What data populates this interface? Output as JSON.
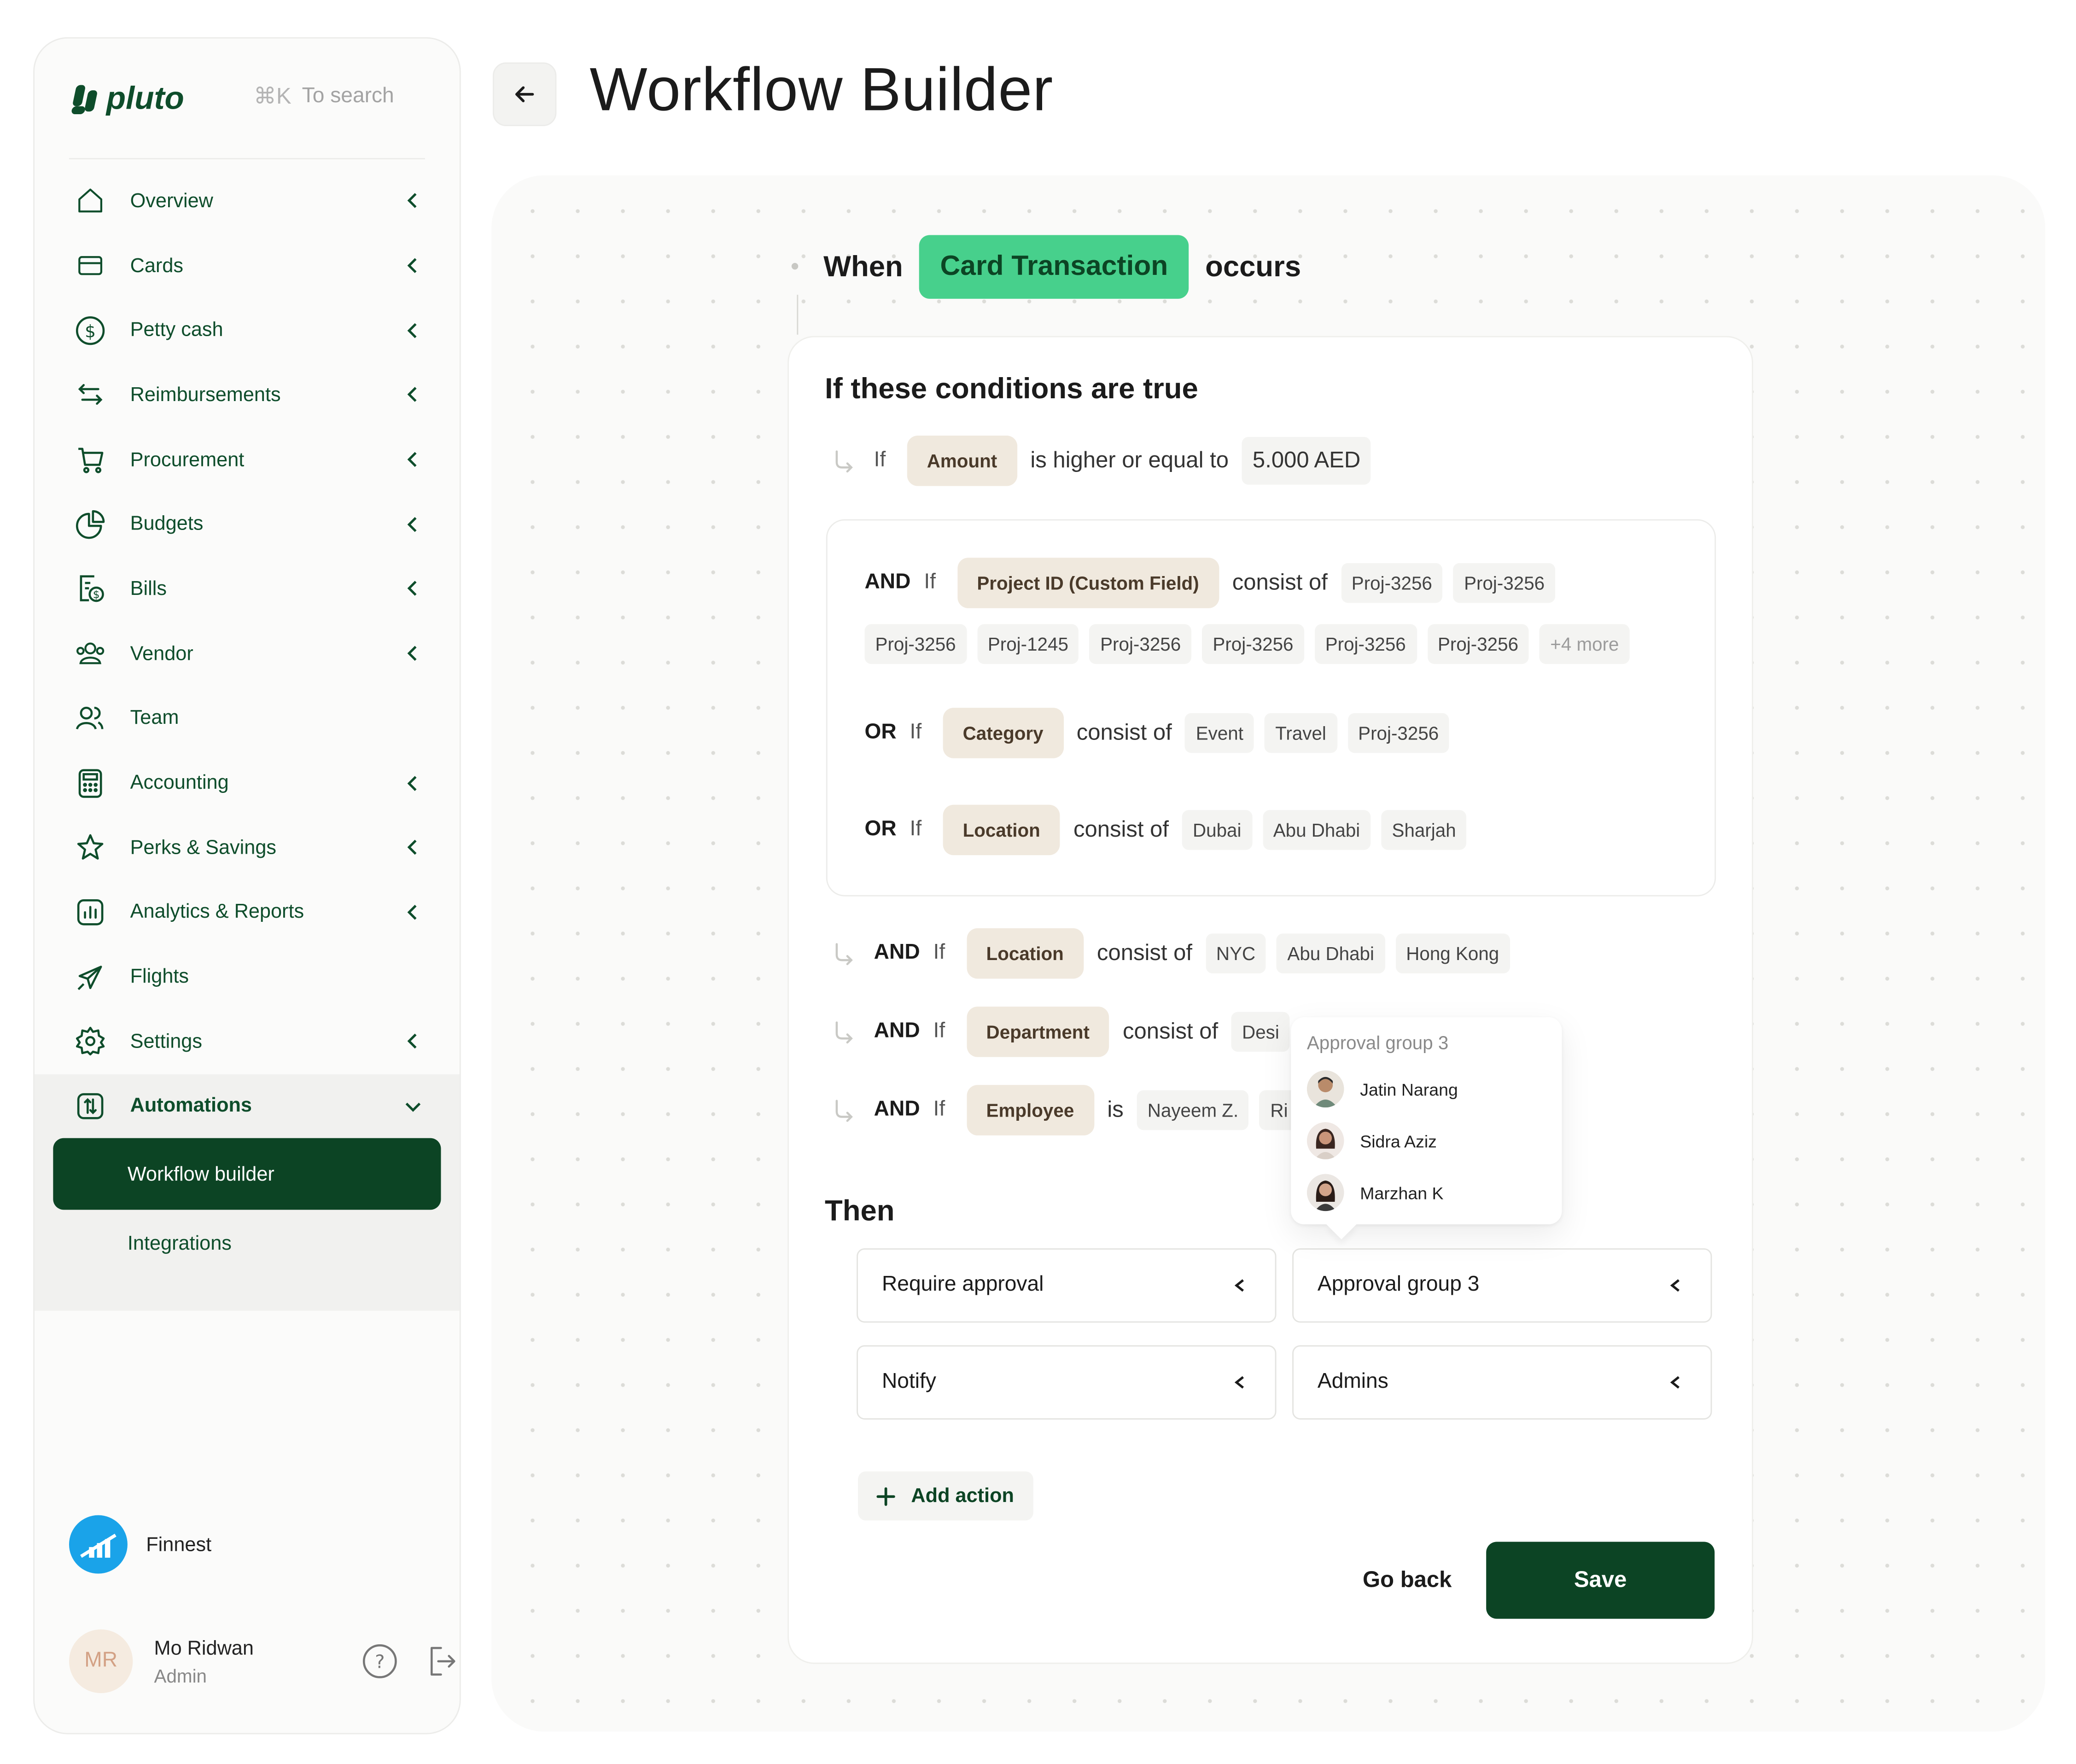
{
  "brand": {
    "name": "pluto"
  },
  "search": {
    "shortcut": "⌘K",
    "hint": "To search"
  },
  "sidebar": {
    "items": [
      {
        "label": "Overview",
        "icon": "home-icon",
        "chevron": true
      },
      {
        "label": "Cards",
        "icon": "card-icon",
        "chevron": true
      },
      {
        "label": "Petty cash",
        "icon": "dollar-icon",
        "chevron": true
      },
      {
        "label": "Reimbursements",
        "icon": "transfer-icon",
        "chevron": true
      },
      {
        "label": "Procurement",
        "icon": "cart-icon",
        "chevron": true
      },
      {
        "label": "Budgets",
        "icon": "pie-icon",
        "chevron": true
      },
      {
        "label": "Bills",
        "icon": "bill-icon",
        "chevron": true
      },
      {
        "label": "Vendor",
        "icon": "vendor-icon",
        "chevron": true
      },
      {
        "label": "Team",
        "icon": "team-icon",
        "chevron": false
      },
      {
        "label": "Accounting",
        "icon": "calculator-icon",
        "chevron": true
      },
      {
        "label": "Perks & Savings",
        "icon": "star-icon",
        "chevron": true
      },
      {
        "label": "Analytics & Reports",
        "icon": "analytics-icon",
        "chevron": true
      },
      {
        "label": "Flights",
        "icon": "plane-icon",
        "chevron": false
      },
      {
        "label": "Settings",
        "icon": "gear-icon",
        "chevron": true
      },
      {
        "label": "Automations",
        "icon": "automation-icon",
        "chevron": true,
        "expanded": true
      }
    ],
    "subitems": [
      {
        "label": "Workflow builder",
        "selected": true
      },
      {
        "label": "Integrations",
        "selected": false
      }
    ],
    "company": "Finnest",
    "user": {
      "initials": "MR",
      "name": "Mo Ridwan",
      "role": "Admin"
    }
  },
  "header": {
    "title": "Workflow Builder"
  },
  "trigger": {
    "when": "When",
    "event": "Card Transaction",
    "occurs": "occurs"
  },
  "conditions": {
    "title": "If these conditions are true",
    "first": {
      "if": "If",
      "field": "Amount",
      "op": "is higher or equal to",
      "value": "5.000 AED"
    },
    "group": {
      "row1": {
        "kw": "AND",
        "if": "If",
        "field": "Project ID (Custom Field)",
        "op": "consist of",
        "chips_a": [
          "Proj-3256",
          "Proj-3256"
        ],
        "chips_b": [
          "Proj-3256",
          "Proj-1245",
          "Proj-3256",
          "Proj-3256",
          "Proj-3256",
          "Proj-3256"
        ],
        "more": "+4 more"
      },
      "row2": {
        "kw": "OR",
        "if": "If",
        "field": "Category",
        "op": "consist of",
        "chips": [
          "Event",
          "Travel",
          "Proj-3256"
        ]
      },
      "row3": {
        "kw": "OR",
        "if": "If",
        "field": "Location",
        "op": "consist of",
        "chips": [
          "Dubai",
          "Abu Dhabi",
          "Sharjah"
        ]
      }
    },
    "after": [
      {
        "kw": "AND",
        "if": "If",
        "field": "Location",
        "op": "consist of",
        "chips": [
          "NYC",
          "Abu Dhabi",
          "Hong Kong"
        ]
      },
      {
        "kw": "AND",
        "if": "If",
        "field": "Department",
        "op": "consist of",
        "chips": [
          "Desi"
        ]
      },
      {
        "kw": "AND",
        "if": "If",
        "field": "Employee",
        "op": "is",
        "chips": [
          "Nayeem Z.",
          "Ri"
        ]
      }
    ]
  },
  "popover": {
    "title": "Approval group 3",
    "people": [
      "Jatin Narang",
      "Sidra Aziz",
      "Marzhan K"
    ]
  },
  "then": {
    "title": "Then",
    "selects": [
      "Require approval",
      "Approval group 3",
      "Notify",
      "Admins"
    ],
    "add_action": "Add action",
    "go_back": "Go back",
    "save": "Save"
  },
  "colors": {
    "brand_dark": "#0c4424",
    "trigger_green": "#47d08c",
    "field_beige": "#f0e9de",
    "company_blue": "#1aa3e9"
  }
}
